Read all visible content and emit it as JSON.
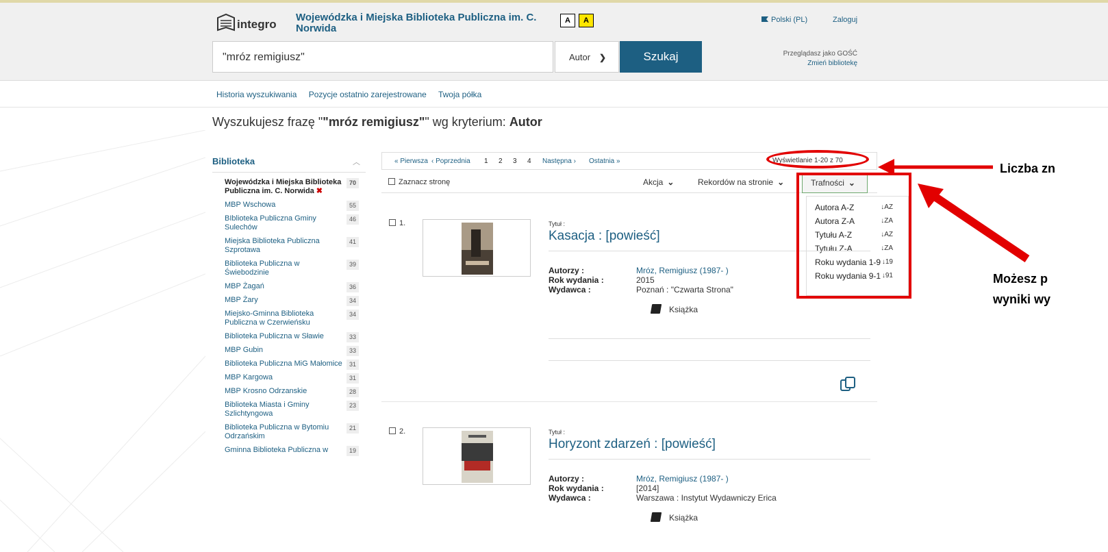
{
  "header": {
    "library_title": "Wojewódzka i Miejska Biblioteka Publiczna im. C. Norwida",
    "contrast_normal": "A",
    "contrast_high": "A",
    "language": "Polski (PL)",
    "login": "Zaloguj",
    "guest_text": "Przeglądasz jako GOŚĆ",
    "change_library": "Zmień bibliotekę",
    "logo_text": "integro"
  },
  "search": {
    "query": "\"mróz remigiusz\"",
    "criterion": "Autor",
    "button": "Szukaj"
  },
  "subnav": [
    "Historia wyszukiwania",
    "Pozycje ostatnio zarejestrowane",
    "Twoja półka"
  ],
  "phrase": {
    "prefix": "Wyszukujesz frazę \"",
    "query": "\"mróz remigiusz\"",
    "middle": "\" wg kryterium: ",
    "criterion": "Autor"
  },
  "facets": {
    "title": "Biblioteka",
    "items": [
      {
        "label": "Wojewódzka i Miejska Biblioteka Publiczna im. C. Norwida",
        "count": "70",
        "selected": true
      },
      {
        "label": "MBP Wschowa",
        "count": "55"
      },
      {
        "label": "BIblioteka Publiczna Gminy Sulechów",
        "count": "46"
      },
      {
        "label": "Miejska Biblioteka Publiczna Szprotawa",
        "count": "41"
      },
      {
        "label": "Biblioteka Publiczna w Świebodzinie",
        "count": "39"
      },
      {
        "label": "MBP Żagań",
        "count": "36"
      },
      {
        "label": "MBP Żary",
        "count": "34"
      },
      {
        "label": "Miejsko-Gminna Biblioteka Publiczna w Czerwieńsku",
        "count": "34"
      },
      {
        "label": "Biblioteka Publiczna w Sławie",
        "count": "33"
      },
      {
        "label": "MBP Gubin",
        "count": "33"
      },
      {
        "label": "Biblioteka Publiczna MiG Małomice",
        "count": "31"
      },
      {
        "label": "MBP Kargowa",
        "count": "31"
      },
      {
        "label": "MBP Krosno Odrzanskie",
        "count": "28"
      },
      {
        "label": "Biblioteka Miasta i Gminy Szlichtyngowa",
        "count": "23"
      },
      {
        "label": "Biblioteka Publiczna w Bytomiu Odrzańskim",
        "count": "21"
      },
      {
        "label": "Gminna Biblioteka Publiczna w",
        "count": "19"
      }
    ]
  },
  "pager": {
    "first": "« Pierwsza",
    "prev": "‹ Poprzednia",
    "pages": [
      "1",
      "2",
      "3",
      "4"
    ],
    "next": "Następna ›",
    "last": "Ostatnia »",
    "display": "Wyświetlanie 1-20 z 70"
  },
  "toolbar": {
    "select_page": "Zaznacz stronę",
    "action": "Akcja",
    "records": "Rekordów na stronie",
    "sort": "Trafności"
  },
  "sort_options": [
    {
      "label": "Autora A-Z",
      "icon": "↓A/Z"
    },
    {
      "label": "Autora Z-A",
      "icon": "↓Z/A"
    },
    {
      "label": "Tytułu A-Z",
      "icon": "↓A/Z"
    },
    {
      "label": "Tytułu Z-A",
      "icon": "↓Z/A"
    },
    {
      "label": "Roku wydania 1-9",
      "icon": "↓1/9"
    },
    {
      "label": "Roku wydania 9-1",
      "icon": "↓9/1"
    }
  ],
  "records": [
    {
      "num": "1.",
      "label": "Tytuł :",
      "title": "Kasacja : [powieść]",
      "author_key": "Autorzy :",
      "author": "Mróz, Remigiusz (1987- )",
      "year_key": "Rok wydania :",
      "year": "2015",
      "publisher_key": "Wydawca :",
      "publisher": "Poznań : \"Czwarta Strona\"",
      "type": "Książka"
    },
    {
      "num": "2.",
      "label": "Tytuł :",
      "title": "Horyzont zdarzeń : [powieść]",
      "author_key": "Autorzy :",
      "author": "Mróz, Remigiusz (1987- )",
      "year_key": "Rok wydania :",
      "year": "[2014]",
      "publisher_key": "Wydawca :",
      "publisher": "Warszawa : Instytut Wydawniczy Erica",
      "type": "Książka"
    }
  ],
  "annotations": {
    "count_text": "Liczba zn",
    "sort_line1": "Możesz p",
    "sort_line2": "wyniki wy"
  },
  "colors": {
    "accent": "#1d5f82",
    "highlight": "#e20000",
    "contrast_yellow": "#ffe600"
  }
}
